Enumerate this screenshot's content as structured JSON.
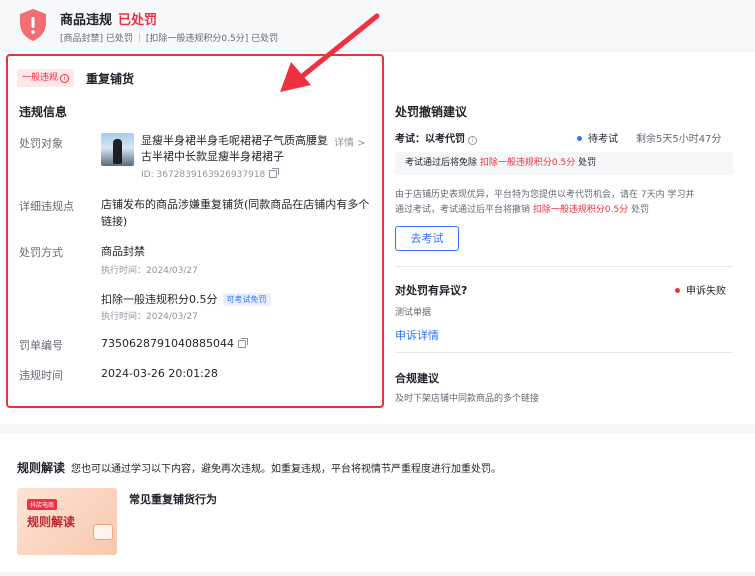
{
  "header": {
    "title": "商品违规",
    "status": "已处罚",
    "sub_item1": "[商品封禁] 已处罚",
    "sub_item2": "[扣除一般违规积分0.5分] 已处罚"
  },
  "violation": {
    "tag": "一般违规",
    "title": "重复铺货",
    "section_title": "违规信息",
    "target_label": "处罚对象",
    "product_name": "显瘦半身裙半身毛呢裙裙子气质高腰复古半裙中长款显瘦半身裙裙子",
    "product_detail": "详情 >",
    "product_id": "ID: 3672839163926937918",
    "detail_label": "详细违规点",
    "detail_text": "店铺发布的商品涉嫌重复铺货(同款商品在店铺内有多个链接)",
    "method_label": "处罚方式",
    "method1": "商品封禁",
    "method1_time": "执行时间：2024/03/27",
    "method2": "扣除一般违规积分0.5分",
    "method2_badge": "可考试免罚",
    "method2_time": "执行时间：2024/03/27",
    "order_label": "罚单编号",
    "order_no": "7350628791040885044",
    "time_label": "违规时间",
    "time_value": "2024-03-26 20:01:28"
  },
  "revoke": {
    "title": "处罚撤销建议",
    "exam_label": "考试：以考代罚",
    "exam_status": "待考试",
    "exam_remaining": "剩余5天5小时47分",
    "notice_prefix": "考试通过后将免除",
    "notice_red": "扣除一般违规积分0.5分",
    "notice_suffix": "处罚",
    "desc_line1": "由于店铺历史表现优异，平台特为您提供以考代罚机会，请在 7天内 学习并",
    "desc_line2_prefix": "通过考试，考试通过后平台将撤销",
    "desc_line2_red": "扣除一般违规积分0.5分",
    "desc_line2_suffix": "处罚",
    "exam_button": "去考试"
  },
  "appeal": {
    "title": "对处罚有异议?",
    "status": "申诉失败",
    "note": "测试单据",
    "link": "申诉详情"
  },
  "compliance": {
    "title": "合规建议",
    "text": "及时下架店铺中同款商品的多个链接"
  },
  "rules": {
    "title": "规则解读",
    "desc": "您也可以通过学习以下内容，避免再次违规。如重复违规，平台将视情节严重程度进行加重处罚。",
    "thumb_badge": "抖店电商",
    "thumb_title": "规则解读",
    "item_title": "常见重复铺货行为"
  },
  "colors": {
    "accent": "#3370ff",
    "danger": "#f0303f",
    "highlight": "#ee3040"
  }
}
